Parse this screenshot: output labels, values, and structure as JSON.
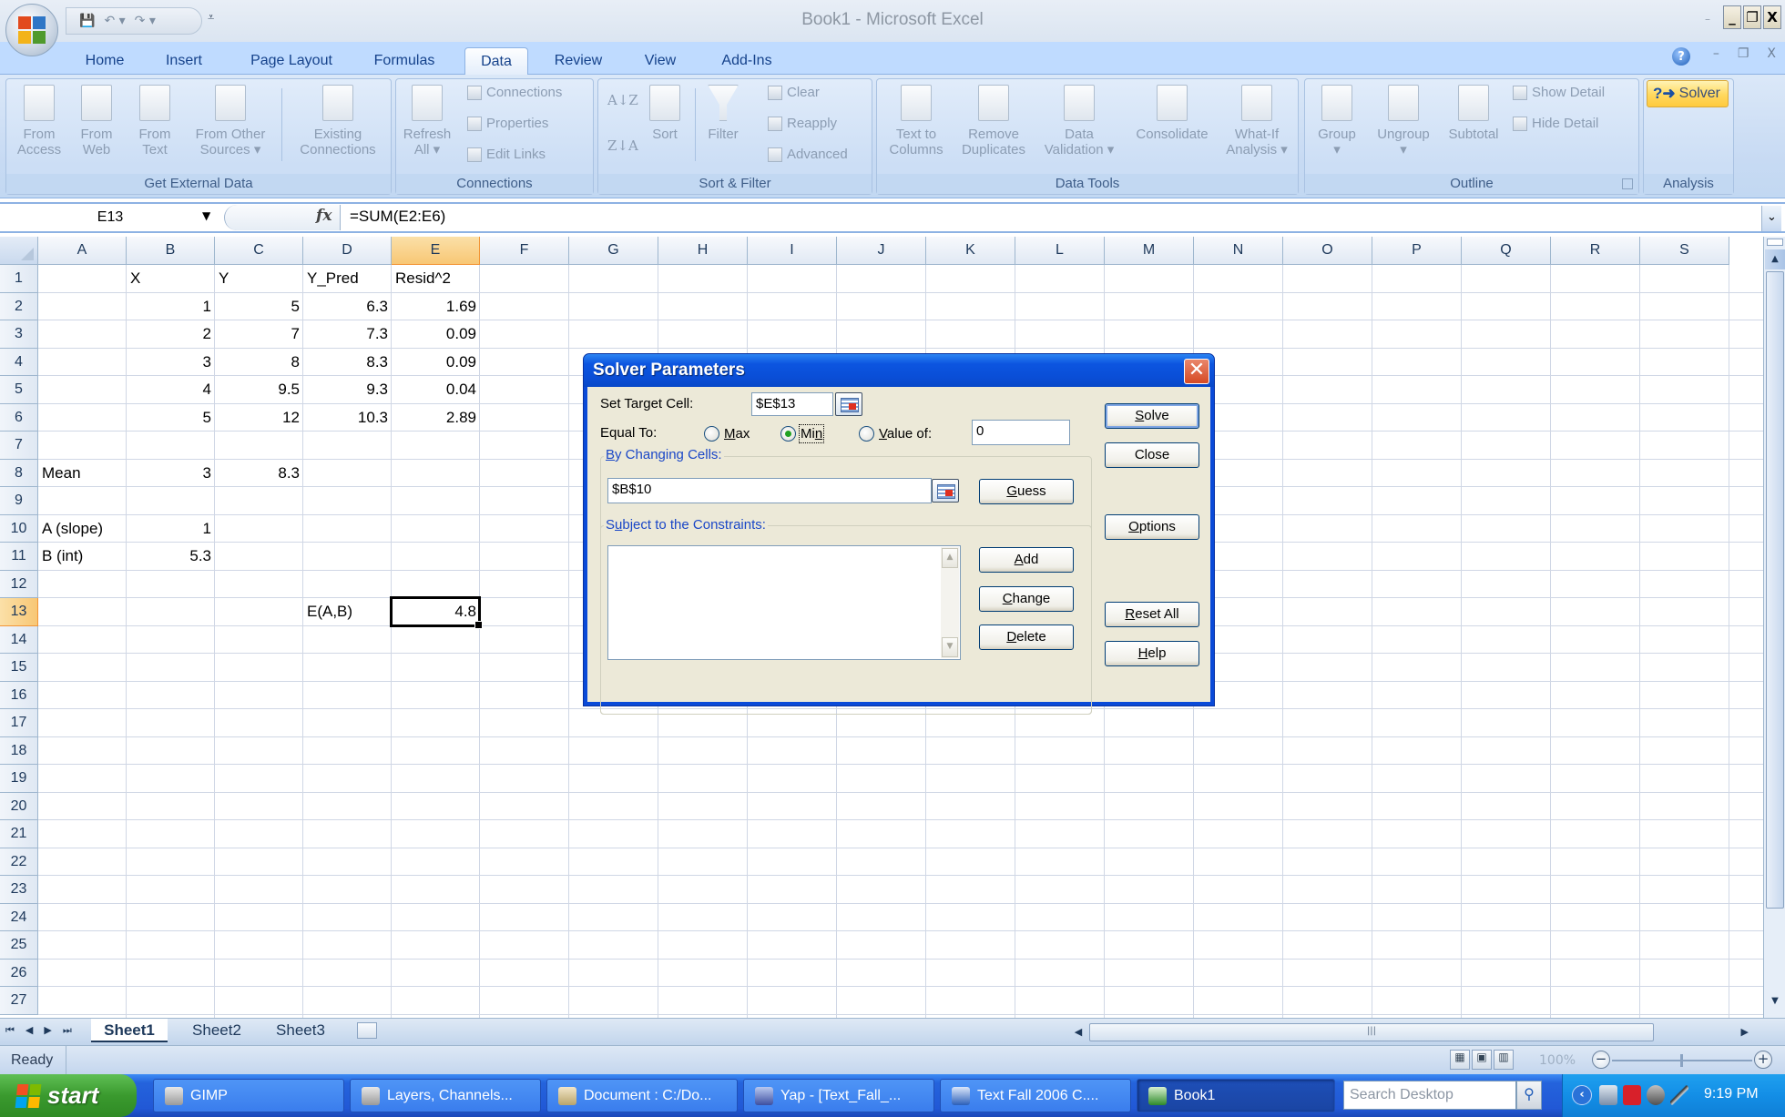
{
  "window": {
    "title": "Book1 - Microsoft Excel",
    "buttons": {
      "minimize": "_",
      "restore": "❐",
      "close": "X"
    }
  },
  "quick_access": {
    "icons": [
      "save-icon",
      "undo-icon",
      "redo-icon",
      "customize-icon"
    ],
    "glyphs": {
      "save": "💾",
      "undo": "↶ ▾",
      "redo": "↷ ▾",
      "customize": "⩡"
    }
  },
  "tabs": [
    "Home",
    "Insert",
    "Page Layout",
    "Formulas",
    "Data",
    "Review",
    "View",
    "Add-Ins"
  ],
  "active_tab": "Data",
  "ribbon": {
    "get_external_data": {
      "label": "Get External Data",
      "buttons": [
        {
          "line1": "From",
          "line2": "Access"
        },
        {
          "line1": "From",
          "line2": "Web"
        },
        {
          "line1": "From",
          "line2": "Text"
        },
        {
          "line1": "From Other",
          "line2": "Sources ▾"
        },
        {
          "line1": "Existing",
          "line2": "Connections"
        }
      ]
    },
    "connections": {
      "label": "Connections",
      "refresh": {
        "line1": "Refresh",
        "line2": "All ▾"
      },
      "small": [
        "Connections",
        "Properties",
        "Edit Links"
      ]
    },
    "sort_filter": {
      "label": "Sort & Filter",
      "sort_az": "A↓Z",
      "sort_za": "Z↓A",
      "sort": "Sort",
      "filter": "Filter",
      "small": [
        "Clear",
        "Reapply",
        "Advanced"
      ]
    },
    "data_tools": {
      "label": "Data Tools",
      "buttons": [
        {
          "line1": "Text to",
          "line2": "Columns"
        },
        {
          "line1": "Remove",
          "line2": "Duplicates"
        },
        {
          "line1": "Data",
          "line2": "Validation ▾"
        },
        {
          "line1": "Consolidate",
          "line2": ""
        },
        {
          "line1": "What-If",
          "line2": "Analysis ▾"
        }
      ]
    },
    "outline": {
      "label": "Outline",
      "buttons": [
        {
          "line1": "Group",
          "line2": "▾"
        },
        {
          "line1": "Ungroup",
          "line2": "▾"
        },
        {
          "line1": "Subtotal",
          "line2": ""
        }
      ],
      "small": [
        "Show Detail",
        "Hide Detail"
      ]
    },
    "analysis": {
      "label": "Analysis",
      "solver": "Solver"
    }
  },
  "formula_bar": {
    "name_box": "E13",
    "fx": "fx",
    "formula": "=SUM(E2:E6)"
  },
  "sheet": {
    "columns": [
      "A",
      "B",
      "C",
      "D",
      "E",
      "F",
      "G",
      "H",
      "I",
      "J",
      "K",
      "L",
      "M",
      "N",
      "O",
      "P",
      "Q",
      "R",
      "S"
    ],
    "rows": [
      "1",
      "2",
      "3",
      "4",
      "5",
      "6",
      "7",
      "8",
      "9",
      "10",
      "11",
      "12",
      "13",
      "14",
      "15",
      "16",
      "17",
      "18",
      "19",
      "20",
      "21",
      "22",
      "23",
      "24",
      "25",
      "26",
      "27"
    ],
    "selected_column": "E",
    "selected_row": "13",
    "active_cell": "E13",
    "cells": [
      {
        "ref": "B1",
        "value": "X",
        "type": "text"
      },
      {
        "ref": "C1",
        "value": "Y",
        "type": "text"
      },
      {
        "ref": "D1",
        "value": "Y_Pred",
        "type": "text"
      },
      {
        "ref": "E1",
        "value": "Resid^2",
        "type": "text"
      },
      {
        "ref": "B2",
        "value": "1",
        "type": "num"
      },
      {
        "ref": "C2",
        "value": "5",
        "type": "num"
      },
      {
        "ref": "D2",
        "value": "6.3",
        "type": "num"
      },
      {
        "ref": "E2",
        "value": "1.69",
        "type": "num"
      },
      {
        "ref": "B3",
        "value": "2",
        "type": "num"
      },
      {
        "ref": "C3",
        "value": "7",
        "type": "num"
      },
      {
        "ref": "D3",
        "value": "7.3",
        "type": "num"
      },
      {
        "ref": "E3",
        "value": "0.09",
        "type": "num"
      },
      {
        "ref": "B4",
        "value": "3",
        "type": "num"
      },
      {
        "ref": "C4",
        "value": "8",
        "type": "num"
      },
      {
        "ref": "D4",
        "value": "8.3",
        "type": "num"
      },
      {
        "ref": "E4",
        "value": "0.09",
        "type": "num"
      },
      {
        "ref": "B5",
        "value": "4",
        "type": "num"
      },
      {
        "ref": "C5",
        "value": "9.5",
        "type": "num"
      },
      {
        "ref": "D5",
        "value": "9.3",
        "type": "num"
      },
      {
        "ref": "E5",
        "value": "0.04",
        "type": "num"
      },
      {
        "ref": "B6",
        "value": "5",
        "type": "num"
      },
      {
        "ref": "C6",
        "value": "12",
        "type": "num"
      },
      {
        "ref": "D6",
        "value": "10.3",
        "type": "num"
      },
      {
        "ref": "E6",
        "value": "2.89",
        "type": "num"
      },
      {
        "ref": "A8",
        "value": "Mean",
        "type": "text"
      },
      {
        "ref": "B8",
        "value": "3",
        "type": "num"
      },
      {
        "ref": "C8",
        "value": "8.3",
        "type": "num"
      },
      {
        "ref": "A10",
        "value": "A (slope)",
        "type": "text"
      },
      {
        "ref": "B10",
        "value": "1",
        "type": "num"
      },
      {
        "ref": "A11",
        "value": "B (int)",
        "type": "text"
      },
      {
        "ref": "B11",
        "value": "5.3",
        "type": "num"
      },
      {
        "ref": "D13",
        "value": "E(A,B)",
        "type": "text"
      },
      {
        "ref": "E13",
        "value": "4.8",
        "type": "num"
      }
    ],
    "tabs": [
      "Sheet1",
      "Sheet2",
      "Sheet3"
    ],
    "active_sheet": "Sheet1"
  },
  "status_bar": {
    "status": "Ready",
    "zoom": "100%"
  },
  "solver_dialog": {
    "title": "Solver Parameters",
    "set_target_cell_label": "Set Target Cell:",
    "set_target_cell_value": "$E$13",
    "equal_to_label": "Equal To:",
    "options": {
      "max": "Max",
      "min": "Min",
      "value_of": "Value of:"
    },
    "selected_option": "Min",
    "value_of": "0",
    "by_changing_cells_label": "By Changing Cells:",
    "by_changing_cells_value": "$B$10",
    "constraints_label": "Subject to the Constraints:",
    "constraints": [],
    "buttons": {
      "solve": "Solve",
      "close": "Close",
      "guess": "Guess",
      "options": "Options",
      "add": "Add",
      "change": "Change",
      "delete": "Delete",
      "reset_all": "Reset All",
      "help": "Help"
    }
  },
  "taskbar": {
    "start": "start",
    "items": [
      {
        "label": "GIMP",
        "icon": "gimp-icon"
      },
      {
        "label": "Layers, Channels...",
        "icon": "gimp-icon"
      },
      {
        "label": "Document : C:/Do...",
        "icon": "document-icon"
      },
      {
        "label": "Yap - [Text_Fall_...",
        "icon": "yap-icon"
      },
      {
        "label": "Text Fall 2006 C....",
        "icon": "word-icon"
      },
      {
        "label": "Book1",
        "icon": "excel-icon"
      }
    ],
    "active_item": "Book1",
    "search_placeholder": "Search Desktop",
    "clock": "9:19 PM"
  },
  "colors": {
    "ribbon_bg": "#c7daf3",
    "tab_text": "#15428b",
    "selected_header": "#f8c775",
    "dialog_title": "#0a4ed7",
    "dialog_body": "#ece9d8",
    "solver_highlight": "#ffd85e",
    "taskbar": "#2158d6",
    "start_green": "#3a9a2e"
  }
}
